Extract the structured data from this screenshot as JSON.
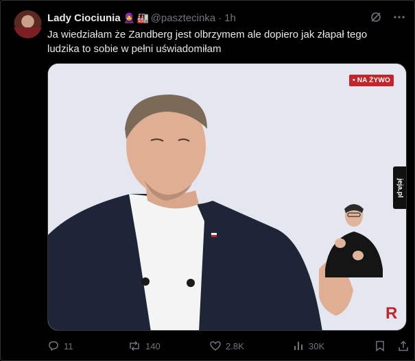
{
  "author": {
    "name": "Lady Ciociunia",
    "handle": "@pasztecinka",
    "separator": "·",
    "time": "1h",
    "emoji_1": "🧕",
    "emoji_2": "🏭"
  },
  "tweet": {
    "text_line_1": "Ja wiedziałam że Zandberg jest olbrzymem ale dopiero jak złapał tego",
    "text_line_2": "ludzika to sobie w pełni uświadomiłam"
  },
  "media": {
    "badge": "• NA ŻYWO",
    "watermark": "jeja.pl",
    "corner_logo": "R"
  },
  "actions": {
    "replies": "11",
    "retweets": "140",
    "likes": "2.8K",
    "views": "30K"
  },
  "icons": {
    "top": [
      "grok-icon",
      "more-icon"
    ],
    "actions": [
      "reply-icon",
      "retweet-icon",
      "like-icon",
      "views-icon",
      "bookmark-icon",
      "share-icon"
    ]
  },
  "colors": {
    "background": "#000000",
    "text": "#e7e9ea",
    "muted": "#71767b",
    "live_red": "#c2262b"
  }
}
